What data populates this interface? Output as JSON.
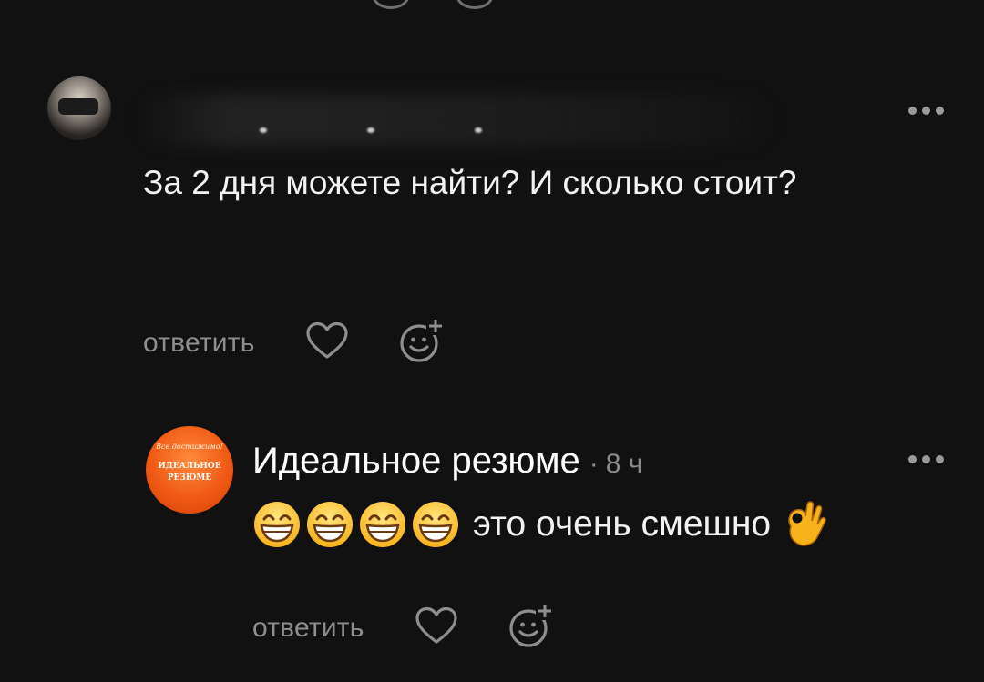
{
  "top_icons": [
    "heart-icon",
    "emoji-react-icon"
  ],
  "comments": [
    {
      "author_visible": false,
      "text": "За 2 дня можете найти? И сколько стоит?",
      "reply_label": "ответить",
      "icons": {
        "more": "more-dots-icon",
        "like": "heart-icon",
        "react": "emoji-react-icon"
      }
    },
    {
      "author": "Идеальное резюме",
      "separator": "·",
      "time": "8 ч",
      "avatar": {
        "script": "Все достижимо!",
        "brand_line1": "ИДЕАЛЬНОЕ",
        "brand_line2": "РЕЗЮМЕ"
      },
      "emojis": [
        "grinning-face-icon",
        "grinning-face-icon",
        "grinning-face-icon",
        "grinning-face-icon"
      ],
      "text": "это очень смешно",
      "trailing_emoji": "ok-hand-icon",
      "reply_label": "ответить",
      "icons": {
        "more": "more-dots-icon",
        "like": "heart-icon",
        "react": "emoji-react-icon"
      }
    }
  ],
  "colors": {
    "background": "#111111",
    "text_primary": "#f2f2f2",
    "text_secondary": "#8e8e8e",
    "avatar_orange": "#f05a14"
  }
}
